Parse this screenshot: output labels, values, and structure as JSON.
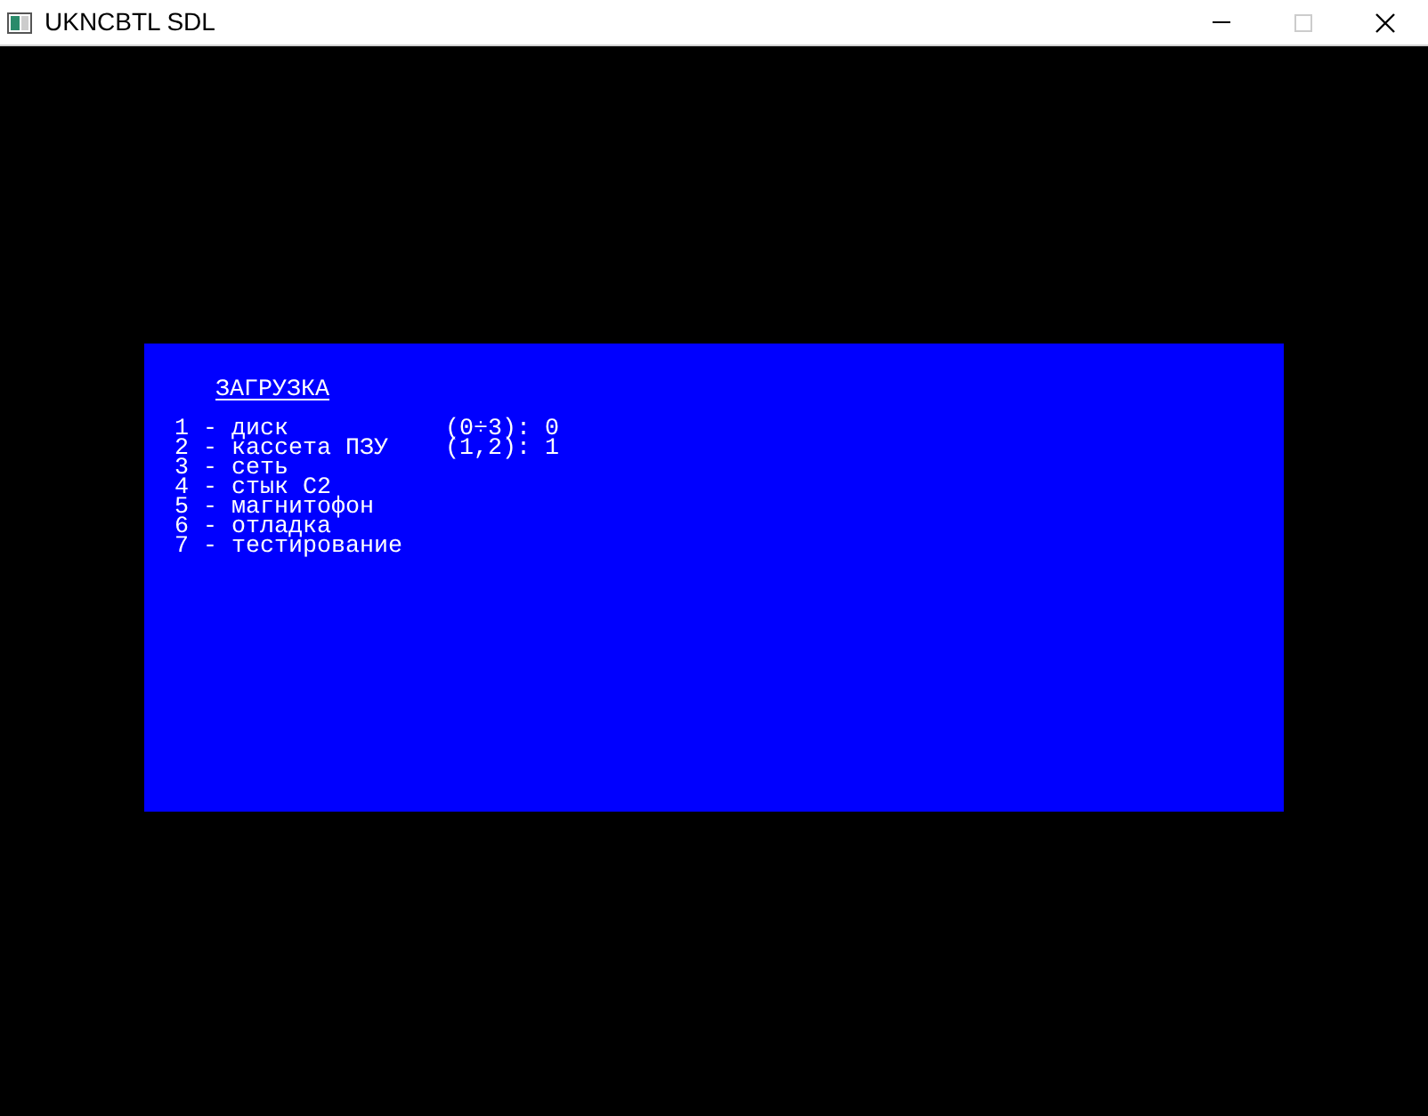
{
  "window": {
    "title": "UKNCBTL SDL"
  },
  "screen": {
    "title": "ЗАГРУЗКА",
    "items": [
      {
        "text": "1 - диск",
        "option": "(0÷3): 0"
      },
      {
        "text": "2 - кассета ПЗУ",
        "option": "(1,2): 1"
      },
      {
        "text": "3 - сеть"
      },
      {
        "text": "4 - стык С2"
      },
      {
        "text": "5 - магнитофон"
      },
      {
        "text": "6 - отладка"
      },
      {
        "text": "7 - тестирование"
      }
    ]
  }
}
